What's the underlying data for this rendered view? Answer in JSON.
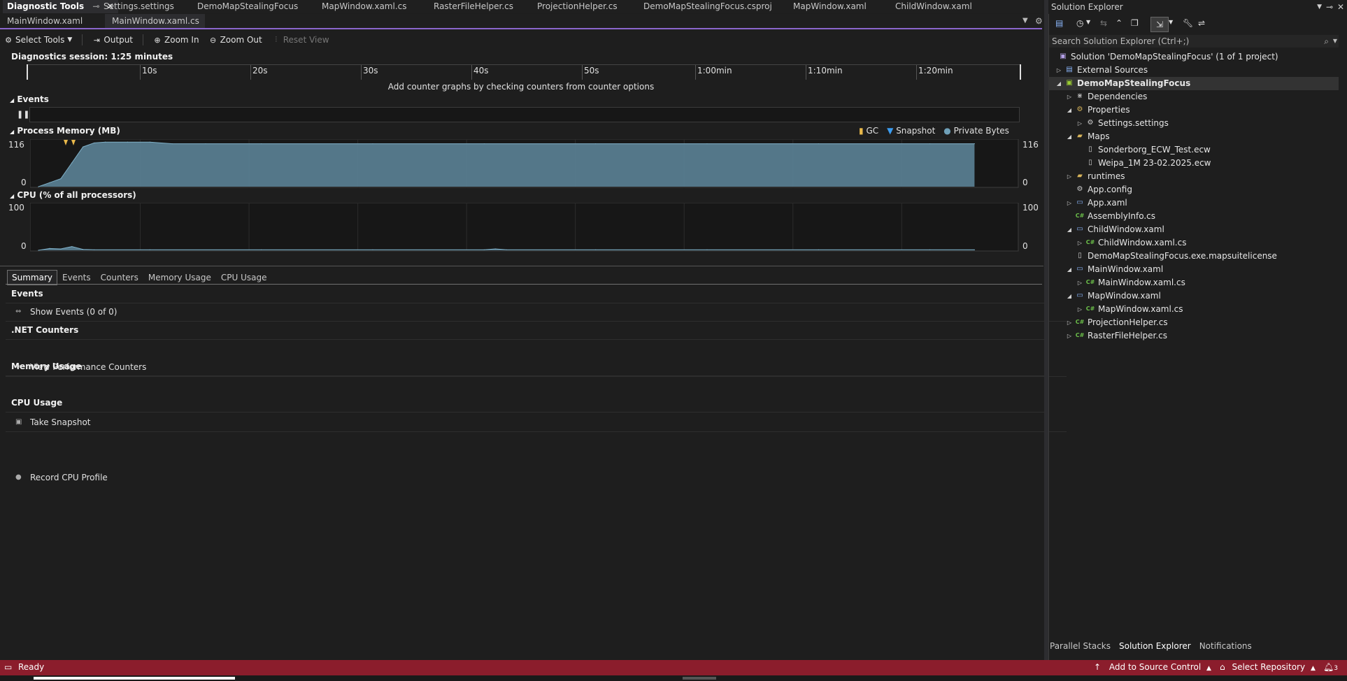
{
  "editor_tabs": [
    {
      "label": "Diagnostic Tools"
    },
    {
      "label": "Settings.settings"
    },
    {
      "label": "DemoMapStealingFocus"
    },
    {
      "label": "MapWindow.xaml.cs"
    },
    {
      "label": "RasterFileHelper.cs"
    },
    {
      "label": "ProjectionHelper.cs"
    },
    {
      "label": "DemoMapStealingFocus.csproj"
    },
    {
      "label": "MapWindow.xaml"
    },
    {
      "label": "ChildWindow.xaml"
    }
  ],
  "editor_tabs_row2": [
    {
      "label": "MainWindow.xaml"
    },
    {
      "label": "MainWindow.xaml.cs"
    }
  ],
  "toolbar": {
    "select_tools": "Select Tools",
    "output": "Output",
    "zoom_in": "Zoom In",
    "zoom_out": "Zoom Out",
    "reset_view": "Reset View"
  },
  "session_label": "Diagnostics session: 1:25 minutes",
  "ruler_ticks": [
    "10s",
    "20s",
    "30s",
    "40s",
    "50s",
    "1:00min",
    "1:10min",
    "1:20min"
  ],
  "counter_hint": "Add counter graphs by checking counters from counter options",
  "events_section": {
    "title": "Events"
  },
  "memory_section": {
    "title": "Process Memory (MB)",
    "y_max": "116",
    "y_min": "0",
    "legend": {
      "gc": "GC",
      "snapshot": "Snapshot",
      "private_bytes": "Private Bytes"
    },
    "colors": {
      "fill": "#5b8296",
      "gc": "#e8b84a",
      "snapshot": "#3b9cf0"
    }
  },
  "cpu_section": {
    "title": "CPU (% of all processors)",
    "y_max": "100",
    "y_min": "0"
  },
  "chart_data": [
    {
      "type": "area",
      "title": "Process Memory (MB)",
      "xlabel": "",
      "ylabel": "",
      "ylim": [
        0,
        116
      ],
      "x": [
        0,
        1,
        2,
        3,
        4,
        5,
        6,
        8,
        10,
        12,
        15,
        20,
        30,
        40,
        50,
        60,
        70,
        80,
        84
      ],
      "series": [
        {
          "name": "Private Bytes",
          "values": [
            0,
            10,
            20,
            60,
            100,
            110,
            112,
            112,
            112,
            108,
            108,
            108,
            108,
            108,
            108,
            108,
            108,
            108,
            108
          ]
        }
      ]
    },
    {
      "type": "area",
      "title": "CPU (% of all processors)",
      "xlabel": "",
      "ylabel": "",
      "ylim": [
        0,
        100
      ],
      "x": [
        0,
        1,
        2,
        3,
        4,
        5,
        10,
        20,
        30,
        40,
        41,
        42,
        50,
        60,
        70,
        80,
        84
      ],
      "series": [
        {
          "values": [
            0,
            4,
            3,
            8,
            2,
            1,
            1,
            1,
            1,
            1,
            3,
            1,
            1,
            1,
            1,
            1,
            1
          ]
        }
      ]
    }
  ],
  "bottom_tabs": [
    "Summary",
    "Events",
    "Counters",
    "Memory Usage",
    "CPU Usage"
  ],
  "summary_rows": [
    {
      "kind": "header",
      "label": "Events"
    },
    {
      "kind": "item",
      "label": "Show Events (0 of 0)",
      "icon": "link-icon"
    },
    {
      "kind": "header",
      "label": ".NET Counters"
    },
    {
      "kind": "item",
      "label": "View Performance Counters",
      "icon": "link-icon"
    },
    {
      "kind": "header",
      "label": "Memory Usage"
    },
    {
      "kind": "item",
      "label": "Take Snapshot",
      "icon": "camera-icon"
    },
    {
      "kind": "header",
      "label": "CPU Usage"
    },
    {
      "kind": "item",
      "label": "Record CPU Profile",
      "icon": "record-icon"
    }
  ],
  "solution_explorer": {
    "title": "Solution Explorer",
    "search_placeholder": "Search Solution Explorer (Ctrl+;)",
    "tree": [
      {
        "label": "Solution 'DemoMapStealingFocus' (1 of 1 project)",
        "level": 0,
        "arrow": "",
        "icon": "solution-icon"
      },
      {
        "label": "External Sources",
        "level": 0,
        "arrow": "collapsed",
        "icon": "external-icon"
      },
      {
        "label": "DemoMapStealingFocus",
        "level": 0,
        "arrow": "expanded",
        "icon": "project-icon",
        "selected": true
      },
      {
        "label": "Dependencies",
        "level": 1,
        "arrow": "collapsed",
        "icon": "dependencies-icon"
      },
      {
        "label": "Properties",
        "level": 1,
        "arrow": "expanded",
        "icon": "properties-icon"
      },
      {
        "label": "Settings.settings",
        "level": 2,
        "arrow": "collapsed",
        "icon": "settings-icon"
      },
      {
        "label": "Maps",
        "level": 1,
        "arrow": "expanded",
        "icon": "folder-icon"
      },
      {
        "label": "Sonderborg_ECW_Test.ecw",
        "level": 2,
        "arrow": "",
        "icon": "file-icon"
      },
      {
        "label": "Weipa_1M 23-02.2025.ecw",
        "level": 2,
        "arrow": "",
        "icon": "file-icon"
      },
      {
        "label": "runtimes",
        "level": 1,
        "arrow": "collapsed",
        "icon": "folder-icon"
      },
      {
        "label": "App.config",
        "level": 1,
        "arrow": "",
        "icon": "config-icon"
      },
      {
        "label": "App.xaml",
        "level": 1,
        "arrow": "collapsed",
        "icon": "xaml-icon"
      },
      {
        "label": "AssemblyInfo.cs",
        "level": 1,
        "arrow": "",
        "icon": "csharp-icon"
      },
      {
        "label": "ChildWindow.xaml",
        "level": 1,
        "arrow": "expanded",
        "icon": "xaml-icon"
      },
      {
        "label": "ChildWindow.xaml.cs",
        "level": 2,
        "arrow": "collapsed",
        "icon": "csharp-icon"
      },
      {
        "label": "DemoMapStealingFocus.exe.mapsuitelicense",
        "level": 1,
        "arrow": "",
        "icon": "file-icon"
      },
      {
        "label": "MainWindow.xaml",
        "level": 1,
        "arrow": "expanded",
        "icon": "xaml-icon"
      },
      {
        "label": "MainWindow.xaml.cs",
        "level": 2,
        "arrow": "collapsed",
        "icon": "csharp-icon"
      },
      {
        "label": "MapWindow.xaml",
        "level": 1,
        "arrow": "expanded",
        "icon": "xaml-icon"
      },
      {
        "label": "MapWindow.xaml.cs",
        "level": 2,
        "arrow": "collapsed",
        "icon": "csharp-icon"
      },
      {
        "label": "ProjectionHelper.cs",
        "level": 1,
        "arrow": "collapsed",
        "icon": "csharp-icon"
      },
      {
        "label": "RasterFileHelper.cs",
        "level": 1,
        "arrow": "collapsed",
        "icon": "csharp-icon"
      }
    ],
    "bottom_tabs": [
      "Parallel Stacks",
      "Solution Explorer",
      "Notifications"
    ]
  },
  "status": {
    "ready": "Ready",
    "add_to_source_control": "Add to Source Control",
    "select_repository": "Select Repository",
    "notification_count": "3"
  },
  "colors": {
    "status_bar": "#8b1d2c",
    "accent": "#8a66cc"
  }
}
